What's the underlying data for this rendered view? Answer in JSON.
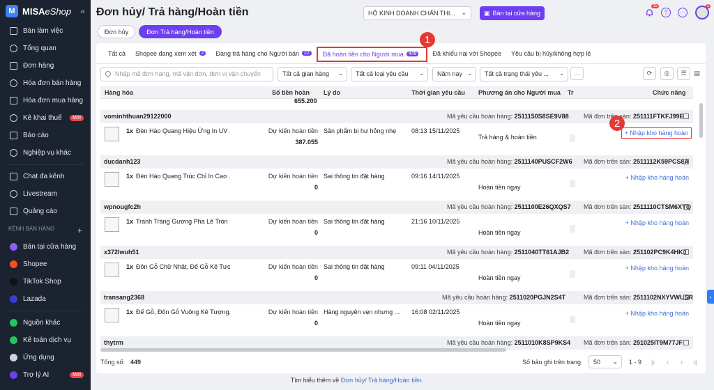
{
  "app": {
    "brand_mark": "M",
    "brand": "MISA",
    "brand_suffix": "eShop",
    "collapse_glyph": "«"
  },
  "sidebar": {
    "items": [
      {
        "label": "Bàn làm việc",
        "icon": "desk-icon"
      },
      {
        "label": "Tổng quan",
        "icon": "dashboard-icon"
      },
      {
        "label": "Đơn hàng",
        "icon": "order-icon"
      },
      {
        "label": "Hóa đơn bán hàng",
        "icon": "invoice-icon"
      },
      {
        "label": "Hóa đơn mua hàng",
        "icon": "purchase-invoice-icon"
      },
      {
        "label": "Kê khai thuế",
        "icon": "tax-icon",
        "badge": "Mới"
      },
      {
        "label": "Báo cáo",
        "icon": "report-icon"
      },
      {
        "label": "Nghiệp vụ khác",
        "icon": "other-ops-icon"
      }
    ],
    "items2": [
      {
        "label": "Chat đa kênh",
        "icon": "chat-icon"
      },
      {
        "label": "Livestream",
        "icon": "livestream-icon"
      },
      {
        "label": "Quảng cáo",
        "icon": "ads-icon"
      }
    ],
    "channel_section": "KÊNH BÁN HÀNG",
    "channel_add": "+",
    "channels": [
      {
        "label": "Bán tại cửa hàng",
        "icon": "store-icon",
        "color": "#8b5cf6"
      },
      {
        "label": "Shopee",
        "icon": "shopee-icon",
        "color": "#f4511e"
      },
      {
        "label": "TikTok Shop",
        "icon": "tiktok-icon",
        "color": "#111111"
      },
      {
        "label": "Lazada",
        "icon": "lazada-icon",
        "color": "#3b3bd6"
      }
    ],
    "items3": [
      {
        "label": "Nguồn khác",
        "icon": "other-source-icon",
        "color": "#22c55e"
      },
      {
        "label": "Kế toán dịch vụ",
        "icon": "accounting-icon",
        "color": "#22c55e"
      },
      {
        "label": "Ứng dụng",
        "icon": "apps-icon",
        "color": "#cfd3da"
      },
      {
        "label": "Trợ lý AI",
        "icon": "ai-icon",
        "color": "#6d3ff0",
        "badge": "Mới"
      }
    ]
  },
  "header": {
    "title": "Đơn hủy/ Trả hàng/Hoàn tiền",
    "business_select": "HỘ KINH DOANH CHẤN THI...",
    "store_button": "Bán tại cửa hàng",
    "notif_count": "15",
    "avatar_badge": "1"
  },
  "primary_tabs": [
    {
      "label": "Đơn hủy",
      "active": false
    },
    {
      "label": "Đơn Trả hàng/Hoàn tiền",
      "active": true
    }
  ],
  "sub_tabs": [
    {
      "label": "Tất cả"
    },
    {
      "label": "Shopee đang xem xét",
      "count": "2"
    },
    {
      "label": "Đang trả hàng cho Người bán",
      "count": "22"
    },
    {
      "label": "Đã hoàn tiền cho Người mua",
      "count": "449",
      "active": true
    },
    {
      "label": "Đã khiếu nại với Shopee"
    },
    {
      "label": "Yêu cầu bị hủy/không hợp lệ"
    }
  ],
  "markers": {
    "one": "1",
    "two": "2"
  },
  "filters": {
    "search_placeholder": "Nhập mã đơn hàng, mã vận đơn, đơn vị vận chuyển",
    "booth": "Tất cả gian hàng",
    "request_type": "Tất cả loại yêu cầu",
    "period": "Năm nay",
    "status": "Tất cả trạng thái yêu ...",
    "more": "···"
  },
  "table": {
    "headers": {
      "product": "Hàng hóa",
      "refund": "Số tiền hoàn",
      "reason": "Lý do",
      "time": "Thời gian yêu cầu",
      "method": "Phương án cho Người mua",
      "extra": "Tr",
      "action": "Chức năng"
    },
    "peek_amount": "655.200",
    "req_label": "Mã yêu cầu hoàn hàng:",
    "ext_label": "Mã đơn trên sàn:",
    "est_label": "Dự kiến hoàn tiền",
    "import_label": "+ Nhập kho hàng hoàn",
    "rows": [
      {
        "user": "vominhthuan29122000",
        "req_code": "2511150S8SE9V88",
        "ext_code": "251111FTKFJ99E",
        "qty": "1x",
        "product": "Đèn Hào Quang Hiệu Ứng In UV ...",
        "amount": "387.055",
        "reason": "Sản phẩm bị hư hỏng nhẹ",
        "time": "08:13 15/11/2025",
        "method": "Trả hàng & hoàn tiền"
      },
      {
        "user": "ducdanh123",
        "req_code": "2511140PUSCF2W6",
        "ext_code": "2511112K59PCS8A",
        "qty": "1x",
        "product": "Đèn Hào Quang Trúc Chỉ In Cao ...",
        "amount": "0",
        "reason": "Sai thông tin đặt hàng",
        "time": "09:16 14/11/2025",
        "method": "Hoàn tiền ngay"
      },
      {
        "user": "wpnougfc2h",
        "req_code": "2511100E26QXQS7",
        "ext_code": "2511110CTSM6XYQ",
        "qty": "1x",
        "product": "Tranh Tráng Gương Pha Lê Tròn ...",
        "amount": "0",
        "reason": "Sai thông tin đặt hàng",
        "time": "21:16 10/11/2025",
        "method": "Hoàn tiền ngay"
      },
      {
        "user": "x372lwuh51",
        "req_code": "2511040TT61AJB2",
        "ext_code": "251102PC9K4HK0",
        "qty": "1x",
        "product": "Đôn Gỗ Chữ Nhật, Đế Gỗ Kê Tượ...",
        "amount": "0",
        "reason": "Sai thông tin đặt hàng",
        "time": "09:11 04/11/2025",
        "method": "Hoàn tiền ngay"
      },
      {
        "user": "transang2368",
        "req_code": "2511020PGJN2S4T",
        "ext_code": "2511102NXYVWUSR",
        "qty": "1x",
        "product": "Đế Gỗ, Đôn Gỗ Vuông Kê Tượng...",
        "amount": "0",
        "reason": "Hàng nguyên vẹn nhưng ...",
        "time": "16:08 02/11/2025",
        "method": "Hoàn tiền ngay"
      },
      {
        "user": "thytrm",
        "req_code": "2511010K8SP9KS4",
        "ext_code": "251025IT9M77JF"
      }
    ]
  },
  "footer": {
    "total_label": "Tổng số:",
    "total": "449",
    "per_page_label": "Số bản ghi trên trang",
    "per_page": "50",
    "range": "1 - 9",
    "first": "|‹",
    "prev": "‹",
    "next": "›",
    "last": "›|"
  },
  "bottom": {
    "text": "Tìm hiểu thêm về",
    "link": "Đơn hủy/ Trả hàng/Hoàn tiền."
  },
  "colors": {
    "accent": "#6d3ff0",
    "annotation": "#e53935",
    "link": "#3f6fd6",
    "sidebar": "#1b2230"
  }
}
